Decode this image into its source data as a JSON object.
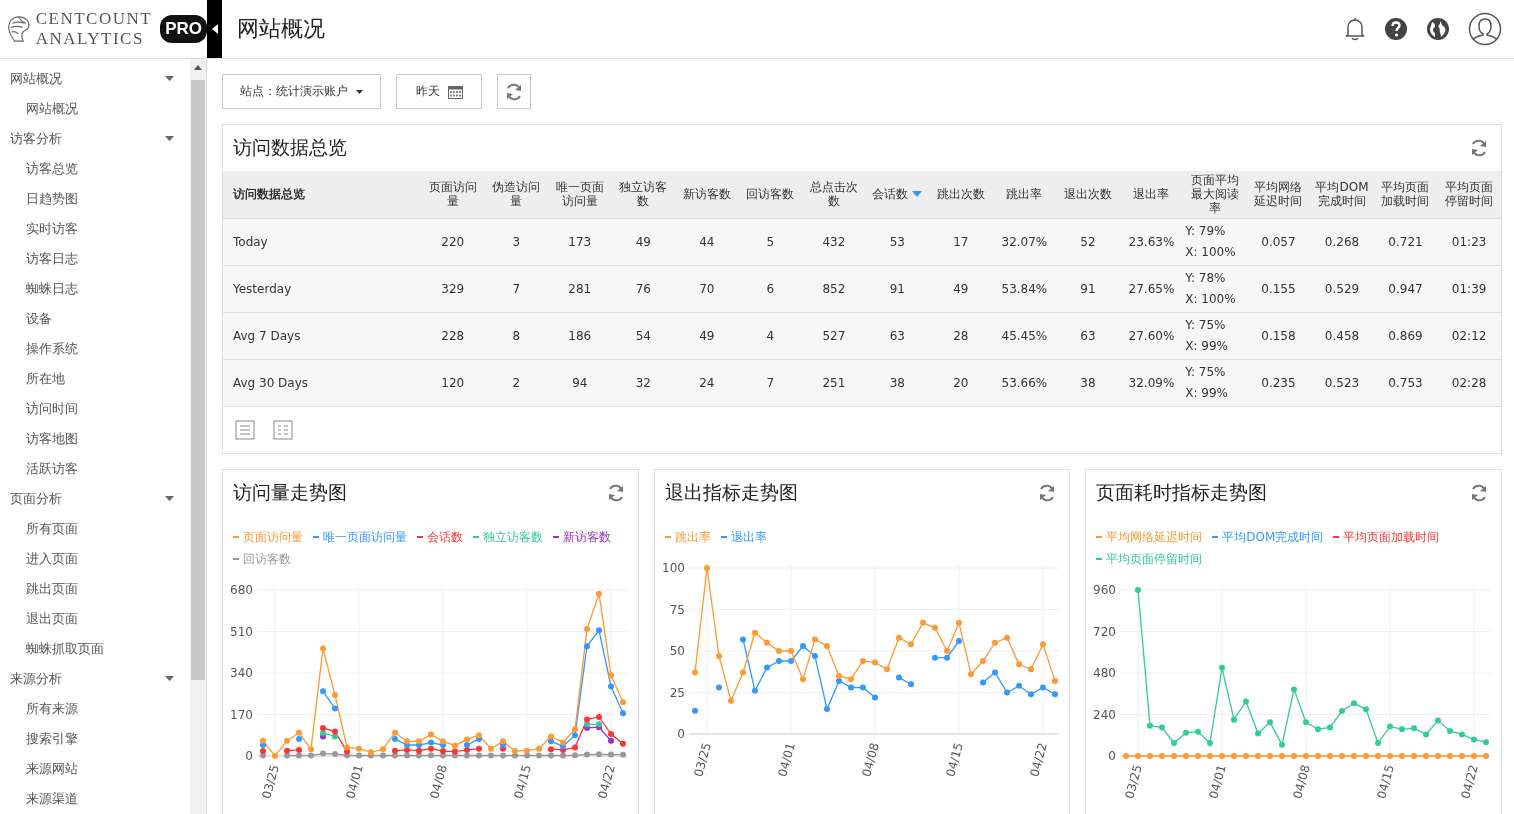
{
  "header": {
    "brand_line1": "CENTCOUNT",
    "brand_line2": "ANALYTICS",
    "badge": "PRO",
    "title": "网站概况"
  },
  "sidebar": {
    "groups": [
      {
        "label": "网站概况",
        "expanded": true,
        "children": [
          {
            "label": "网站概况"
          }
        ]
      },
      {
        "label": "访客分析",
        "expanded": true,
        "children": [
          {
            "label": "访客总览"
          },
          {
            "label": "日趋势图"
          },
          {
            "label": "实时访客"
          },
          {
            "label": "访客日志"
          },
          {
            "label": "蜘蛛日志"
          },
          {
            "label": "设备"
          },
          {
            "label": "操作系统"
          },
          {
            "label": "所在地"
          },
          {
            "label": "访问时间"
          },
          {
            "label": "访客地图"
          },
          {
            "label": "活跃访客"
          }
        ]
      },
      {
        "label": "页面分析",
        "expanded": true,
        "children": [
          {
            "label": "所有页面"
          },
          {
            "label": "进入页面"
          },
          {
            "label": "跳出页面"
          },
          {
            "label": "退出页面"
          },
          {
            "label": "蜘蛛抓取页面"
          }
        ]
      },
      {
        "label": "来源分析",
        "expanded": true,
        "children": [
          {
            "label": "所有来源"
          },
          {
            "label": "搜索引擎"
          },
          {
            "label": "来源网站"
          },
          {
            "label": "来源渠道"
          }
        ]
      }
    ]
  },
  "toolbar": {
    "site_selector": "站点：统计演示账户",
    "date_button": "昨天"
  },
  "summary": {
    "title": "访问数据总览",
    "columns": [
      {
        "label": "访问数据总览",
        "sorted": false
      },
      {
        "label": "页面访问量",
        "sorted": false
      },
      {
        "label": "伪造访问量",
        "sorted": false
      },
      {
        "label": "唯一页面访问量",
        "sorted": false
      },
      {
        "label": "独立访客数",
        "sorted": false
      },
      {
        "label": "新访客数",
        "sorted": false
      },
      {
        "label": "回访客数",
        "sorted": false
      },
      {
        "label": "总点击次数",
        "sorted": false
      },
      {
        "label": "会话数",
        "sorted": true
      },
      {
        "label": "跳出次数",
        "sorted": false
      },
      {
        "label": "跳出率",
        "sorted": false
      },
      {
        "label": "退出次数",
        "sorted": false
      },
      {
        "label": "退出率",
        "sorted": false
      },
      {
        "label": "页面平均最大阅读率",
        "sorted": false
      },
      {
        "label": "平均网络延迟时间",
        "sorted": false
      },
      {
        "label": "平均DOM完成时间",
        "sorted": false
      },
      {
        "label": "平均页面加载时间",
        "sorted": false
      },
      {
        "label": "平均页面停留时间",
        "sorted": false
      }
    ],
    "rows": [
      {
        "cells": [
          "Today",
          "220",
          "3",
          "173",
          "49",
          "44",
          "5",
          "432",
          "53",
          "17",
          "32.07%",
          "52",
          "23.63%",
          [
            "Y: 79%",
            "X: 100%"
          ],
          "0.057",
          "0.268",
          "0.721",
          "01:23"
        ]
      },
      {
        "cells": [
          "Yesterday",
          "329",
          "7",
          "281",
          "76",
          "70",
          "6",
          "852",
          "91",
          "49",
          "53.84%",
          "91",
          "27.65%",
          [
            "Y: 78%",
            "X: 100%"
          ],
          "0.155",
          "0.529",
          "0.947",
          "01:39"
        ]
      },
      {
        "cells": [
          "Avg 7 Days",
          "228",
          "8",
          "186",
          "54",
          "49",
          "4",
          "527",
          "63",
          "28",
          "45.45%",
          "63",
          "27.60%",
          [
            "Y: 75%",
            "X: 99%"
          ],
          "0.158",
          "0.458",
          "0.869",
          "02:12"
        ]
      },
      {
        "cells": [
          "Avg 30 Days",
          "120",
          "2",
          "94",
          "32",
          "24",
          "7",
          "251",
          "38",
          "20",
          "53.66%",
          "38",
          "32.09%",
          [
            "Y: 75%",
            "X: 99%"
          ],
          "0.235",
          "0.523",
          "0.753",
          "02:28"
        ]
      }
    ]
  },
  "charts": [
    {
      "title": "访问量走势图",
      "chart_data": {
        "type": "line",
        "grid": true,
        "categories": [
          null,
          "03/25",
          null,
          null,
          null,
          null,
          null,
          null,
          "04/01",
          null,
          null,
          null,
          null,
          null,
          null,
          "04/08",
          null,
          null,
          null,
          null,
          null,
          null,
          "04/15",
          null,
          null,
          null,
          null,
          null,
          null,
          "04/22",
          null
        ],
        "ylim": [
          0,
          680
        ],
        "yticks": [
          0,
          170,
          340,
          510,
          680
        ],
        "series": [
          {
            "name": "页面访问量",
            "color": "#ff9933",
            "marker": "circle",
            "values": [
              62,
              0,
              62,
              95,
              28,
              440,
              250,
              35,
              30,
              15,
              28,
              95,
              60,
              60,
              88,
              60,
              42,
              68,
              85,
              30,
              60,
              20,
              22,
              30,
              80,
              55,
              110,
              520,
              665,
              330,
              220
            ]
          },
          {
            "name": "唯一页面访问量",
            "color": "#3399ff",
            "marker": "circle",
            "values": [
              45,
              null,
              null,
              70,
              null,
              265,
              195,
              null,
              null,
              null,
              null,
              70,
              45,
              45,
              55,
              45,
              null,
              45,
              70,
              null,
              45,
              null,
              null,
              null,
              60,
              40,
              85,
              450,
              515,
              285,
              175
            ]
          },
          {
            "name": "会话数",
            "color": "#ff3333",
            "marker": "circle",
            "values": [
              20,
              null,
              22,
              25,
              null,
              115,
              100,
              18,
              null,
              null,
              null,
              22,
              25,
              22,
              30,
              20,
              18,
              25,
              30,
              null,
              30,
              null,
              null,
              null,
              28,
              25,
              35,
              150,
              160,
              90,
              50
            ]
          },
          {
            "name": "独立访客数",
            "color": "#33cc99",
            "marker": "circle",
            "values": [
              null,
              null,
              null,
              null,
              null,
              95,
              80,
              null,
              null,
              null,
              null,
              null,
              null,
              null,
              null,
              null,
              null,
              null,
              null,
              null,
              null,
              null,
              null,
              null,
              null,
              null,
              null,
              130,
              130,
              null,
              null
            ]
          },
          {
            "name": "新访客数",
            "color": "#9933cc",
            "marker": "circle",
            "values": [
              null,
              null,
              null,
              null,
              null,
              80,
              null,
              null,
              null,
              null,
              null,
              null,
              null,
              null,
              null,
              null,
              null,
              null,
              null,
              null,
              null,
              null,
              null,
              null,
              null,
              null,
              null,
              115,
              118,
              62,
              null
            ]
          },
          {
            "name": "回访客数",
            "color": "#999999",
            "marker": "circle",
            "values": [
              2,
              null,
              2,
              2,
              2,
              10,
              8,
              2,
              2,
              2,
              2,
              2,
              2,
              2,
              3,
              2,
              2,
              2,
              2,
              2,
              2,
              2,
              2,
              2,
              2,
              2,
              3,
              6,
              7,
              6,
              5
            ]
          }
        ]
      }
    },
    {
      "title": "退出指标走势图",
      "chart_data": {
        "type": "line",
        "grid": true,
        "categories": [
          null,
          "03/25",
          null,
          null,
          null,
          null,
          null,
          null,
          "04/01",
          null,
          null,
          null,
          null,
          null,
          null,
          "04/08",
          null,
          null,
          null,
          null,
          null,
          null,
          "04/15",
          null,
          null,
          null,
          null,
          null,
          null,
          "04/22",
          null
        ],
        "ylim": [
          0,
          100
        ],
        "yticks": [
          0,
          25,
          50,
          75,
          100
        ],
        "series": [
          {
            "name": "跳出率",
            "color": "#ff9933",
            "marker": "circle",
            "values": [
              37,
              100,
              47,
              20,
              37,
              61,
              55,
              50,
              50,
              33,
              57,
              53,
              35,
              33,
              44,
              43,
              39,
              58,
              54,
              67,
              64,
              50,
              67,
              36,
              44,
              55,
              58,
              42,
              39,
              54,
              32
            ]
          },
          {
            "name": "退出率",
            "color": "#3399ff",
            "marker": "circle",
            "values": [
              14,
              null,
              28,
              null,
              57,
              26,
              40,
              44,
              44,
              53,
              47,
              15,
              32,
              28,
              28,
              22,
              null,
              34,
              30,
              null,
              46,
              46,
              56,
              null,
              31,
              37,
              25,
              29,
              24,
              28,
              24
            ]
          }
        ]
      }
    },
    {
      "title": "页面耗时指标走势图",
      "chart_data": {
        "type": "line",
        "grid": true,
        "categories": [
          null,
          "03/25",
          null,
          null,
          null,
          null,
          null,
          null,
          "04/01",
          null,
          null,
          null,
          null,
          null,
          null,
          "04/08",
          null,
          null,
          null,
          null,
          null,
          null,
          "04/15",
          null,
          null,
          null,
          null,
          null,
          null,
          "04/22",
          null
        ],
        "ylim": [
          0,
          960
        ],
        "yticks": [
          0,
          240,
          480,
          720,
          960
        ],
        "series": [
          {
            "name": "平均网络延迟时间",
            "color": "#ff9933",
            "marker": "circle",
            "values": [
              0,
              0,
              0,
              0,
              0,
              0,
              0,
              0,
              0,
              0,
              0,
              0,
              0,
              0,
              0,
              0,
              0,
              0,
              0,
              0,
              0,
              0,
              0,
              0,
              0,
              0,
              0,
              0,
              0,
              0,
              0
            ]
          },
          {
            "name": "平均DOM完成时间",
            "color": "#3399ff",
            "marker": "circle",
            "values": [
              null,
              null,
              null,
              null,
              null,
              null,
              null,
              null,
              null,
              null,
              null,
              null,
              null,
              null,
              null,
              null,
              null,
              null,
              null,
              null,
              null,
              null,
              null,
              null,
              null,
              null,
              null,
              null,
              null,
              null,
              null
            ]
          },
          {
            "name": "平均页面加载时间",
            "color": "#ff3333",
            "marker": "circle",
            "values": [
              null,
              null,
              null,
              null,
              null,
              null,
              null,
              null,
              null,
              null,
              null,
              null,
              null,
              null,
              null,
              null,
              null,
              null,
              null,
              null,
              null,
              null,
              null,
              null,
              null,
              null,
              null,
              null,
              null,
              null,
              null
            ]
          },
          {
            "name": "平均页面停留时间",
            "color": "#33cc99",
            "marker": "circle",
            "values": [
              null,
              960,
              175,
              165,
              75,
              135,
              140,
              75,
              510,
              210,
              315,
              130,
              195,
              65,
              385,
              195,
              155,
              165,
              260,
              305,
              270,
              75,
              170,
              155,
              160,
              125,
              205,
              145,
              125,
              95,
              80
            ]
          }
        ]
      }
    }
  ]
}
